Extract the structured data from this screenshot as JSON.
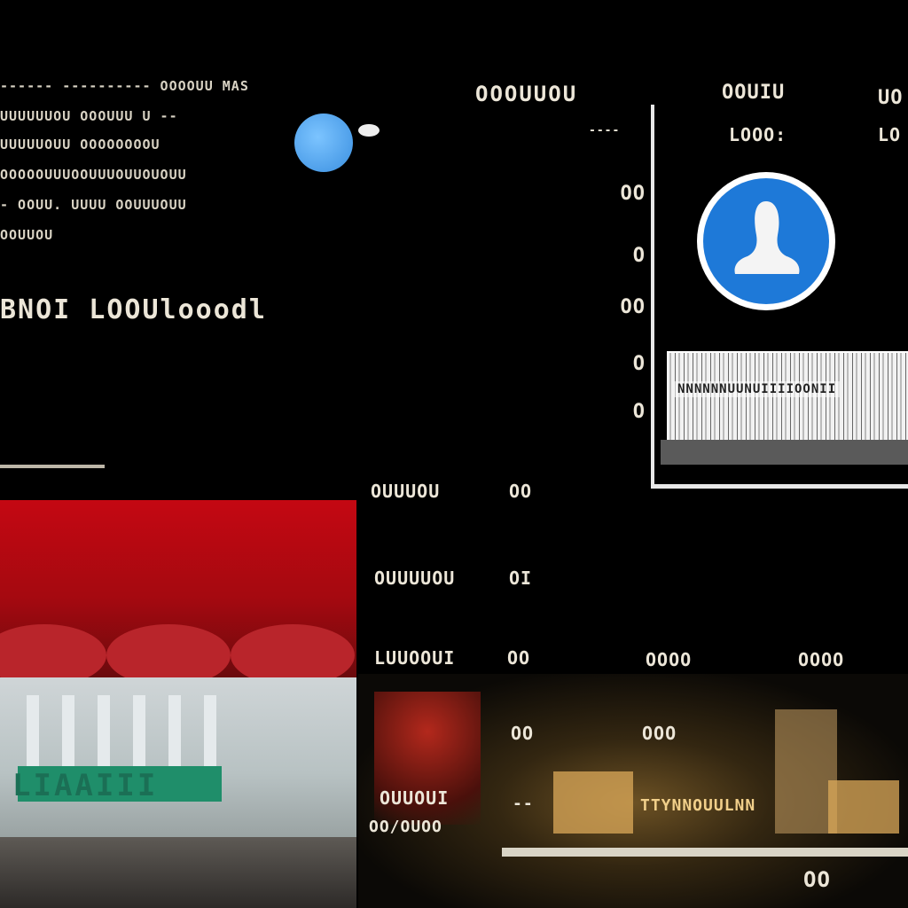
{
  "top_left": {
    "lines": [
      "------ ---------- OOOOUU MAS",
      "UUUUUUOU  OOOUUU  U --",
      "UUUUUOUU  OOOOOOOOU",
      "OOOOOUUUOOUUUOUUOUOUU",
      "- OOUU.  UUUU OOUUUOUU",
      "OOUUOU"
    ],
    "code": "BNOI  LOOUlooodl"
  },
  "mid": {
    "header": "OOOUUOU",
    "sub": "----",
    "numbers": [
      "OO",
      "O",
      "OO",
      "O",
      "O"
    ]
  },
  "right_panel": {
    "col1_head": "OOUIU",
    "col1_sub": "LOOO:",
    "col2_head": "UO",
    "col2_sub": "LO",
    "barcode_label": "NNNNNNUUNUIIIIOONII",
    "avatar_icon": "user-icon",
    "accent": "#1e79d8"
  },
  "photo_left": {
    "sign": "LIAAIII",
    "awning_color": "#c40812"
  },
  "rows": [
    {
      "label": "OUUUOU",
      "value": "OO"
    },
    {
      "label": "OUUUUOU",
      "value": "OI"
    },
    {
      "label": "LUUOOUI",
      "value": "OO",
      "col2": "OOOO",
      "col3": "OOOO"
    },
    {
      "label": "",
      "value": "OO",
      "col2": "OOO"
    }
  ],
  "photo_right": {
    "cap1": "OUUOUI",
    "cap2": "OO/OUOO",
    "dash": "--",
    "sign": "TTYNNOUULNN",
    "counter": "OO"
  }
}
